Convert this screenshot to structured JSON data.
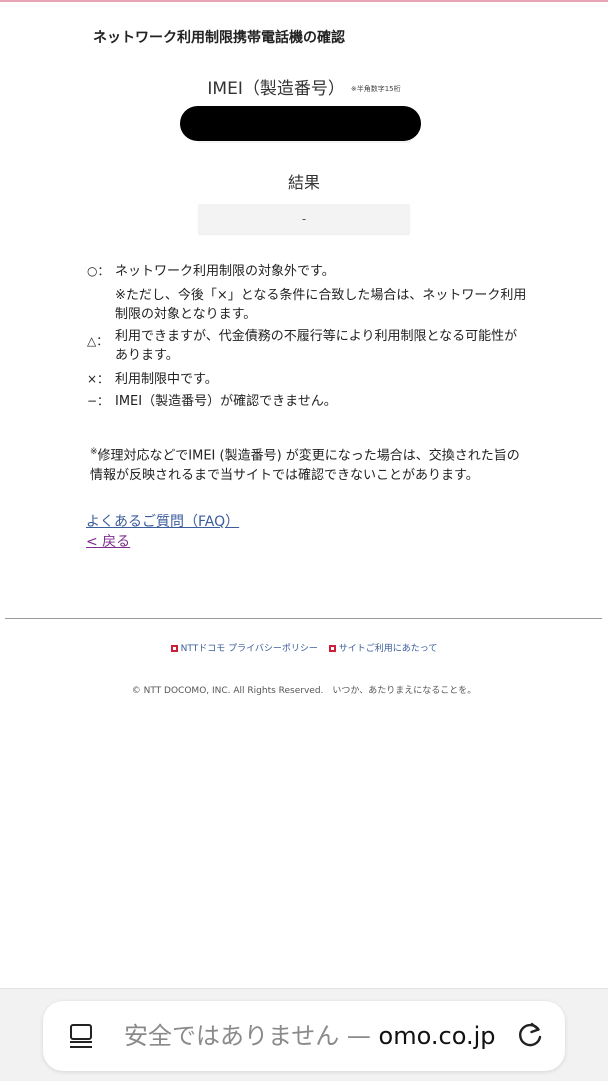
{
  "page": {
    "title": "ネットワーク利用制限携帯電話機の確認"
  },
  "imei": {
    "label": "IMEI（製造番号）",
    "note": "※半角数字15桁",
    "value": ""
  },
  "result": {
    "label": "結果",
    "value": "-"
  },
  "legend": [
    {
      "symbol": "○：",
      "text": "ネットワーク利用制限の対象外です。"
    },
    {
      "symbol": "",
      "text": "※ただし、今後「×」となる条件に合致した場合は、ネットワーク利用制限の対象となります。"
    },
    {
      "symbol": "△：",
      "text": "利用できますが、代金債務の不履行等により利用制限となる可能性があります。"
    },
    {
      "symbol": "×：",
      "text": "利用制限中です。"
    },
    {
      "symbol": "−：",
      "text": "IMEI（製造番号）が確認できません。"
    }
  ],
  "note": {
    "mark": "※",
    "text": "修理対応などでIMEI (製造番号) が変更になった場合は、交換された旨の情報が反映されるまで当サイトでは確認できないことがあります。"
  },
  "links": {
    "faq": "よくあるご質問（FAQ）",
    "back": "< 戻る"
  },
  "footer": {
    "privacy": "NTTドコモ プライバシーポリシー",
    "terms": "サイトご利用にあたって",
    "copyright": "© NTT DOCOMO, INC. All Rights Reserved.　いつか、あたりまえになることを。"
  },
  "browser": {
    "url_warning": "安全ではありません — ",
    "url_host": "omo.co.jp",
    "icons": [
      "tabs-icon",
      "reload-icon"
    ]
  },
  "colors": {
    "accent_top": "#e9a3b6",
    "link": "#3a5d9c",
    "visited_link": "#7c2d8c",
    "footer_marker": "#cc1f3a"
  }
}
